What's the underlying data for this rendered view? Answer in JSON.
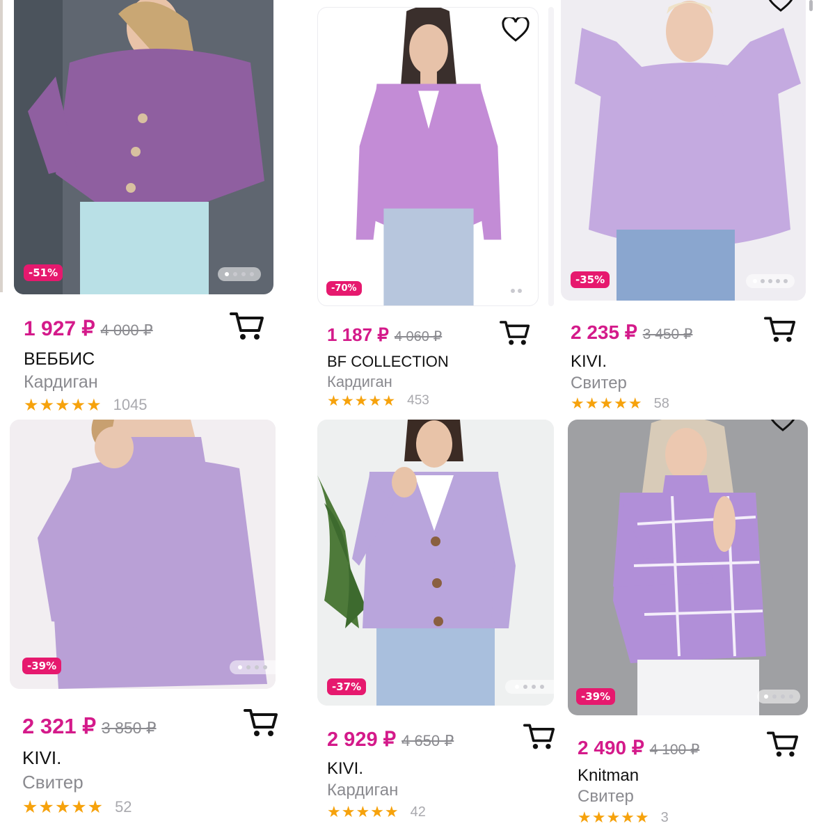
{
  "products": [
    {
      "discount": "-51%",
      "price": "1 927 ₽",
      "old_price": "4 000 ₽",
      "brand": "ВЕББИС",
      "type": "Кардиган",
      "stars": "★★★★★",
      "reviews": "1045",
      "garment_color": "#8f5fa0",
      "bg_color": "#5f6670",
      "pants_color": "#b9e0e6"
    },
    {
      "discount": "-70%",
      "price": "1 187 ₽",
      "old_price": "4 060 ₽",
      "brand": "BF COLLECTION",
      "type": "Кардиган",
      "stars": "★★★★★",
      "reviews": "453",
      "garment_color": "#c38cd6",
      "bg_color": "#ffffff",
      "pants_color": "#b7c6dd"
    },
    {
      "discount": "-35%",
      "price": "2 235 ₽",
      "old_price": "3 450 ₽",
      "brand": "KIVI.",
      "type": "Свитер",
      "stars": "★★★★★",
      "reviews": "58",
      "garment_color": "#c4aae0",
      "bg_color": "#efedf2",
      "pants_color": "#8aa6cf"
    },
    {
      "discount": "-39%",
      "price": "2 321 ₽",
      "old_price": "3 850 ₽",
      "brand": "KIVI.",
      "type": "Свитер",
      "stars": "★★★★★",
      "reviews": "52",
      "garment_color": "#b9a0d6",
      "bg_color": "#f2eef1",
      "pants_color": "#b9a0d6"
    },
    {
      "discount": "-37%",
      "price": "2 929 ₽",
      "old_price": "4 650 ₽",
      "brand": "KIVI.",
      "type": "Кардиган",
      "stars": "★★★★★",
      "reviews": "42",
      "garment_color": "#b9a5dc",
      "bg_color": "#eef0f0",
      "pants_color": "#a9bfdd"
    },
    {
      "discount": "-39%",
      "price": "2 490 ₽",
      "old_price": "4 100 ₽",
      "brand": "Knitman",
      "type": "Свитер",
      "stars": "★★★★★",
      "reviews": "3",
      "garment_color": "#b18fd8",
      "bg_color": "#9fa0a3",
      "pants_color": "#f3f3f5"
    }
  ],
  "icons": {
    "favorite": "heart-icon",
    "cart": "cart-icon",
    "rating": "star-icon"
  },
  "colors": {
    "price": "#d41a8a",
    "badge": "#e6196e",
    "star": "#f6a20c",
    "muted": "#8a8a8f"
  }
}
